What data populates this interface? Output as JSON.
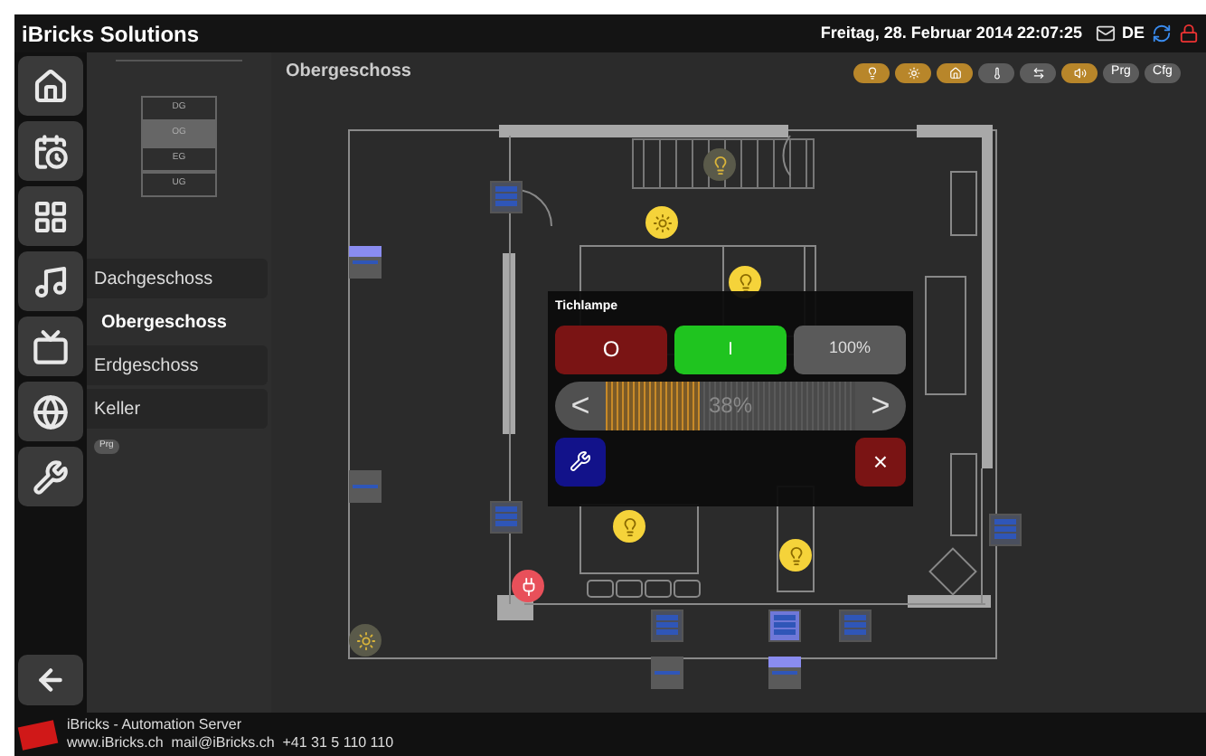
{
  "header": {
    "title": "iBricks Solutions",
    "datetime": "Freitag, 28. Februar 2014 22:07:25",
    "language": "DE"
  },
  "house_levels": [
    {
      "label": "DG",
      "selected": false
    },
    {
      "label": "OG",
      "selected": true
    },
    {
      "label": "EG",
      "selected": false
    },
    {
      "label": "UG",
      "selected": false
    }
  ],
  "floors": [
    {
      "label": "Dachgeschoss",
      "selected": false
    },
    {
      "label": "Obergeschoss",
      "selected": true
    },
    {
      "label": "Erdgeschoss",
      "selected": false
    },
    {
      "label": "Keller",
      "selected": false
    }
  ],
  "panel_badge": "Prg",
  "floor_title": "Obergeschoss",
  "toolbar": [
    {
      "kind": "bulb",
      "active": true
    },
    {
      "kind": "sun",
      "active": true
    },
    {
      "kind": "house",
      "active": true
    },
    {
      "kind": "temperature",
      "active": false
    },
    {
      "kind": "arrows",
      "active": false
    },
    {
      "kind": "speaker",
      "active": true
    },
    {
      "kind": "text",
      "label": "Prg",
      "active": false
    },
    {
      "kind": "text",
      "label": "Cfg",
      "active": false
    }
  ],
  "devices": [
    {
      "kind": "light",
      "on": false
    },
    {
      "kind": "ceiling_light",
      "on": true
    },
    {
      "kind": "light",
      "on": true
    },
    {
      "kind": "blind",
      "on": false
    },
    {
      "kind": "shade",
      "on": true
    },
    {
      "kind": "shade",
      "on": false
    },
    {
      "kind": "blind",
      "on": false
    },
    {
      "kind": "blind",
      "on": false
    },
    {
      "kind": "light",
      "on": true
    },
    {
      "kind": "light",
      "on": true
    },
    {
      "kind": "socket",
      "on": true
    },
    {
      "kind": "ceiling_light",
      "on": false
    },
    {
      "kind": "blind",
      "on": false
    },
    {
      "kind": "blind",
      "on": true
    },
    {
      "kind": "blind",
      "on": false
    },
    {
      "kind": "shade",
      "on": false
    },
    {
      "kind": "shade",
      "on": true
    }
  ],
  "dialog": {
    "title": "Tichlampe",
    "off_label": "O",
    "on_label": "I",
    "full_label": "100%",
    "on": true,
    "dec_label": "<",
    "inc_label": ">",
    "reading": "38%",
    "level": 0.38,
    "close_label": "×"
  },
  "footer": {
    "line1": "iBricks - Automation Server",
    "line2": "www.iBricks.ch  mail@iBricks.ch  +41 31 5 110 110"
  }
}
